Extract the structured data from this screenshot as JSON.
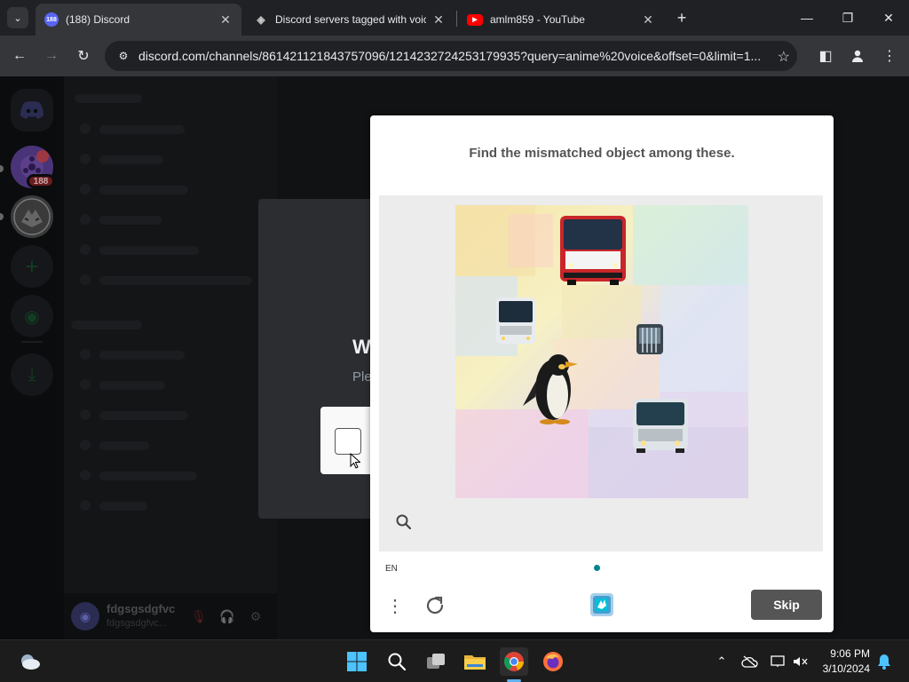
{
  "browser": {
    "tabs": [
      {
        "title": "(188) Discord",
        "badge": "188",
        "active": true
      },
      {
        "title": "Discord servers tagged with voice",
        "active": false
      },
      {
        "title": "amlm859 - YouTube",
        "active": false
      }
    ],
    "url": "discord.com/channels/861421121843757096/1214232724253179935?query=anime%20voice&offset=0&limit=1..."
  },
  "discord": {
    "server_badge": "188",
    "user": {
      "name": "fdgsgsdgfvc",
      "tag": "fdgsgsdgfvc..."
    },
    "modal": {
      "title_fragment": "W",
      "subtitle_fragment": "Ple"
    }
  },
  "captcha": {
    "prompt": "Find the mismatched object among these.",
    "language": "EN",
    "skip_label": "Skip",
    "objects": [
      "bus",
      "bus",
      "bus",
      "bus",
      "penguin"
    ]
  },
  "taskbar": {
    "time": "9:06 PM",
    "date": "3/10/2024"
  },
  "colors": {
    "accent": "#00838f",
    "discord_blurple": "#5865f2",
    "skip_button": "#555555"
  }
}
